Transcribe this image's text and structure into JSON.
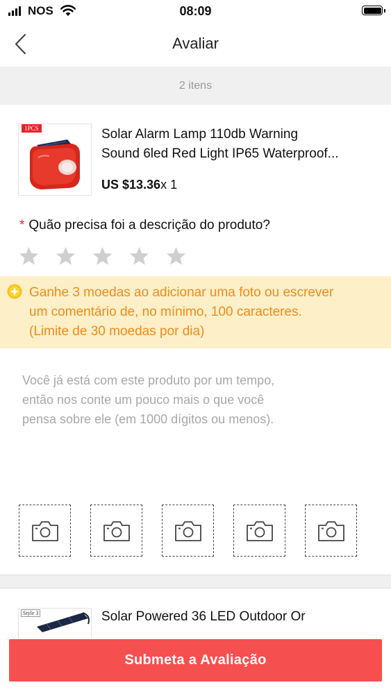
{
  "status_bar": {
    "carrier": "NOS",
    "time": "08:09"
  },
  "header": {
    "title": "Avaliar"
  },
  "items_count": "2 itens",
  "products": [
    {
      "image_tag": "1PCS",
      "title_line1": "Solar Alarm Lamp 110db Warning",
      "title_line2": "Sound 6led Red Light IP65 Waterproof...",
      "price": "US $13.36",
      "quantity": "x 1"
    },
    {
      "image_tag": "Style 3",
      "title_line1": "Solar Powered 36 LED Outdoor Or"
    }
  ],
  "rating": {
    "required_mark": "*",
    "question": "Quão precisa foi a descrição do produto?",
    "stars_total": 5,
    "stars_selected": 0
  },
  "notice": {
    "line1": "Ganhe 3 moedas ao adicionar uma foto ou escrever",
    "line2": "um comentário de, no mínimo, 100 caracteres.",
    "line3": "(Limite de 30 moedas por dia)"
  },
  "review": {
    "placeholder_line1": "Você já está com este produto por um tempo,",
    "placeholder_line2": "então nos conte um pouco mais o que você",
    "placeholder_line3": "pensa sobre ele (em 1000 dígitos ou menos)."
  },
  "photo_slots": 5,
  "submit_label": "Submeta a Avaliação",
  "colors": {
    "accent": "#f64f4f",
    "required": "#e8232a",
    "notice_bg": "#fdf0c8",
    "notice_text": "#f08a19",
    "star": "#cfcfcf"
  }
}
